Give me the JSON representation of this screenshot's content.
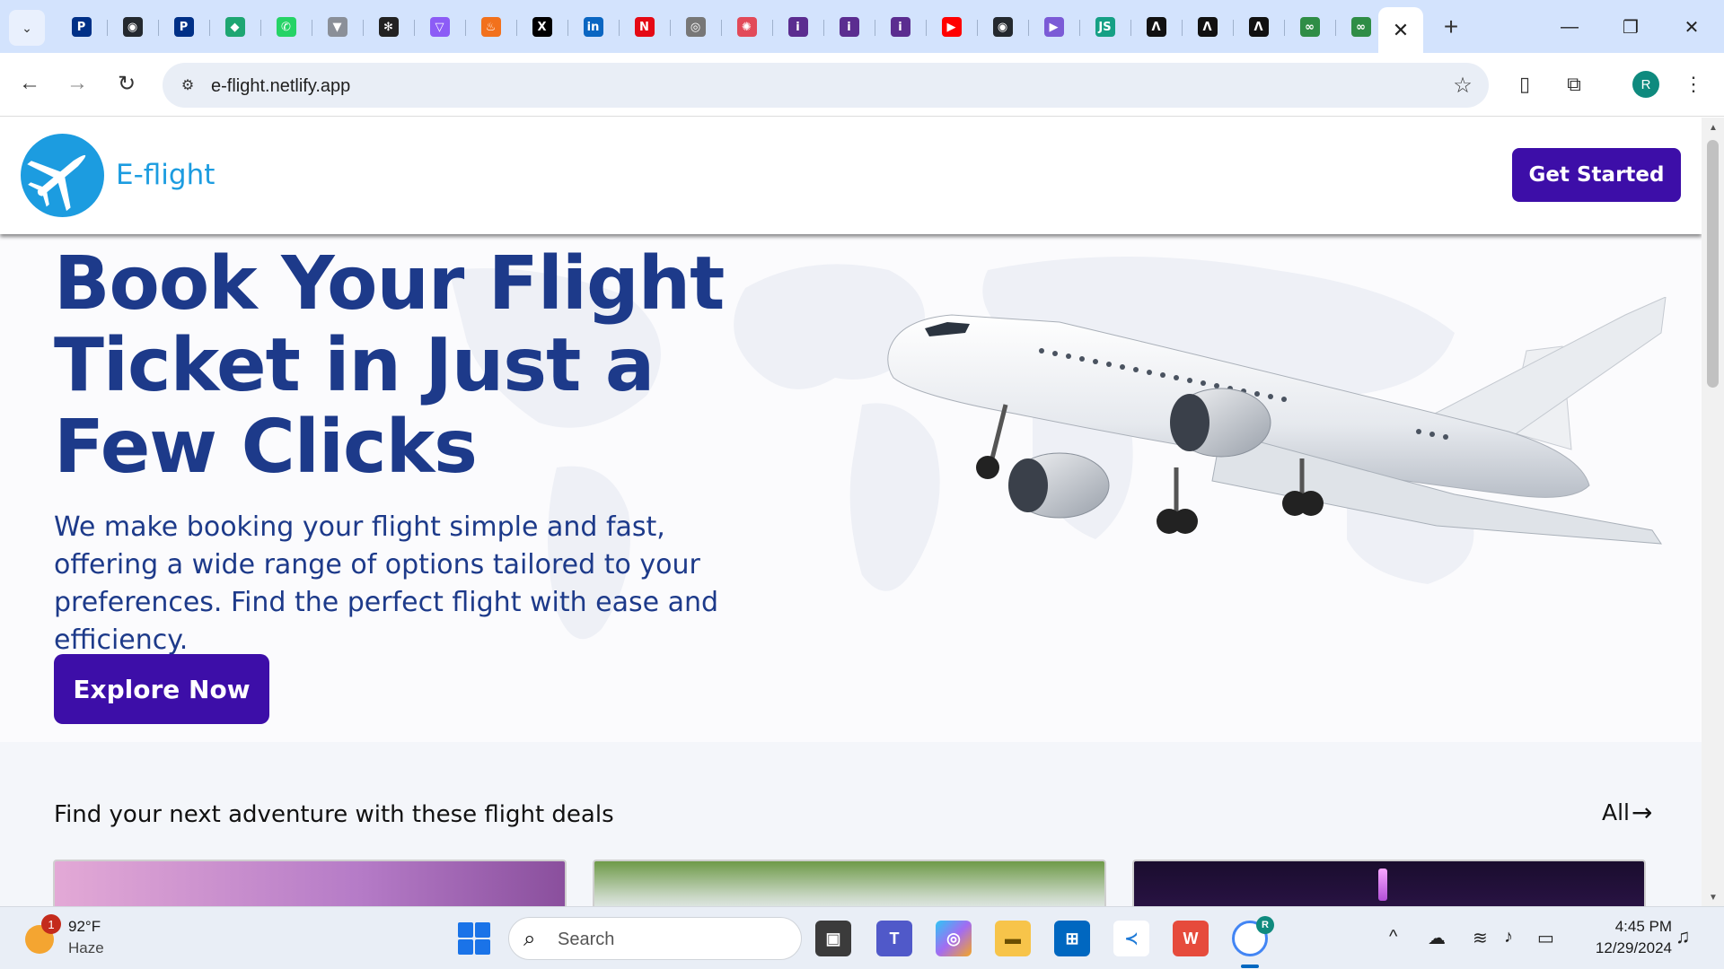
{
  "browser": {
    "url": "e-flight.netlify.app",
    "pinned_tabs": [
      {
        "name": "paypal",
        "glyph": "P",
        "color": "#003087"
      },
      {
        "name": "github",
        "glyph": "◉",
        "color": "#24292f"
      },
      {
        "name": "paypal-2",
        "glyph": "P",
        "color": "#003087"
      },
      {
        "name": "diamond",
        "glyph": "◆",
        "color": "#1ea672"
      },
      {
        "name": "whatsapp",
        "glyph": "✆",
        "color": "#25d366"
      },
      {
        "name": "vector",
        "glyph": "▼",
        "color": "#8a8f98"
      },
      {
        "name": "chatgpt",
        "glyph": "✻",
        "color": "#222222"
      },
      {
        "name": "vite",
        "glyph": "▽",
        "color": "#8c5cf6"
      },
      {
        "name": "flame",
        "glyph": "♨",
        "color": "#f2711c"
      },
      {
        "name": "x",
        "glyph": "X",
        "color": "#000000"
      },
      {
        "name": "linkedin",
        "glyph": "in",
        "color": "#0a66c2"
      },
      {
        "name": "netflix",
        "glyph": "N",
        "color": "#e50914"
      },
      {
        "name": "instagram",
        "glyph": "◎",
        "color": "#777777"
      },
      {
        "name": "octopus",
        "glyph": "✺",
        "color": "#e24a59"
      },
      {
        "name": "indeed-1",
        "glyph": "i",
        "color": "#5b2d90"
      },
      {
        "name": "indeed-2",
        "glyph": "i",
        "color": "#5b2d90"
      },
      {
        "name": "indeed-3",
        "glyph": "i",
        "color": "#5b2d90"
      },
      {
        "name": "youtube",
        "glyph": "▶",
        "color": "#ff0000"
      },
      {
        "name": "github-2",
        "glyph": "◉",
        "color": "#24292f"
      },
      {
        "name": "play",
        "glyph": "▶",
        "color": "#7b5bd6"
      },
      {
        "name": "javascript",
        "glyph": "JS",
        "color": "#16a085"
      },
      {
        "name": "devto-1",
        "glyph": "Λ",
        "color": "#111111"
      },
      {
        "name": "devto-2",
        "glyph": "Λ",
        "color": "#111111"
      },
      {
        "name": "devto-3",
        "glyph": "Λ",
        "color": "#111111"
      },
      {
        "name": "gfg-1",
        "glyph": "∞",
        "color": "#2f8d46"
      },
      {
        "name": "gfg-2",
        "glyph": "∞",
        "color": "#2f8d46"
      }
    ],
    "profile_initial": "R"
  },
  "site": {
    "brand": "E-flight",
    "cta": "Get Started",
    "hero": {
      "headline": "Book Your Flight Ticket in Just a Few Clicks",
      "subtext": "We make booking your flight simple and fast, offering a wide range of options tailored to your preferences. Find the perfect flight with ease and efficiency.",
      "button": "Explore Now"
    },
    "deals": {
      "title": "Find your next adventure with these flight deals",
      "all_label": "All"
    },
    "colors": {
      "primary": "#3d0ea8",
      "heading": "#1d3a8a",
      "brand": "#1c9ce0"
    }
  },
  "taskbar": {
    "weather_temp": "92°F",
    "weather_cond": "Haze",
    "weather_badge": "1",
    "search_placeholder": "Search",
    "time": "4:45 PM",
    "date": "12/29/2024",
    "chrome_badge": "R"
  }
}
